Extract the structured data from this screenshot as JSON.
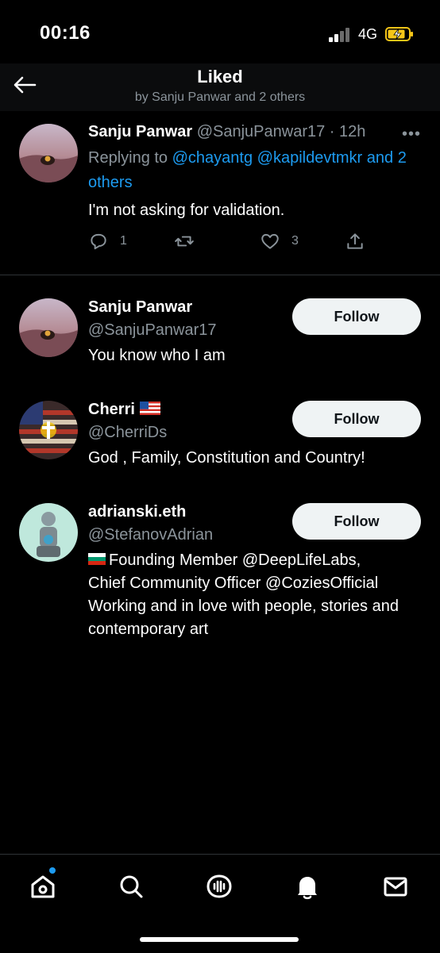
{
  "status": {
    "time": "00:16",
    "network": "4G"
  },
  "header": {
    "title": "Liked",
    "subtitle": "by Sanju Panwar and 2 others"
  },
  "tweet": {
    "name": "Sanju Panwar",
    "handle": "@SanjuPanwar17",
    "time": "· 12h",
    "more": "•••",
    "replying_prefix": "Replying to ",
    "replying_users": "@chayantg @kapildevtmkr",
    "replying_and": " and",
    "replying_others": "2 others",
    "text": "I'm not asking for validation.",
    "reply_count": "1",
    "like_count": "3"
  },
  "users": [
    {
      "name": "Sanju Panwar",
      "handle": "@SanjuPanwar17",
      "bio": "You know who I am",
      "follow_label": "Follow"
    },
    {
      "name": "Cherri",
      "handle": "@CherriDs",
      "bio": "God , Family, Constitution and Country!",
      "follow_label": "Follow"
    },
    {
      "name": "adrianski.eth",
      "handle": "@StefanovAdrian",
      "bio_line1": "Founding Member @DeepLifeLabs,",
      "bio_rest": "Chief Community Officer @CoziesOfficial Working and in love with people, stories and contemporary art",
      "follow_label": "Follow"
    }
  ],
  "colors": {
    "accent": "#1d9bf0",
    "background": "#000000",
    "muted": "#8b949b",
    "battery": "#f5c518"
  },
  "icons": [
    "back-arrow-icon",
    "reply-icon",
    "retweet-icon",
    "heart-icon",
    "share-icon",
    "home-icon",
    "search-icon",
    "spaces-icon",
    "bell-icon",
    "mail-icon"
  ]
}
